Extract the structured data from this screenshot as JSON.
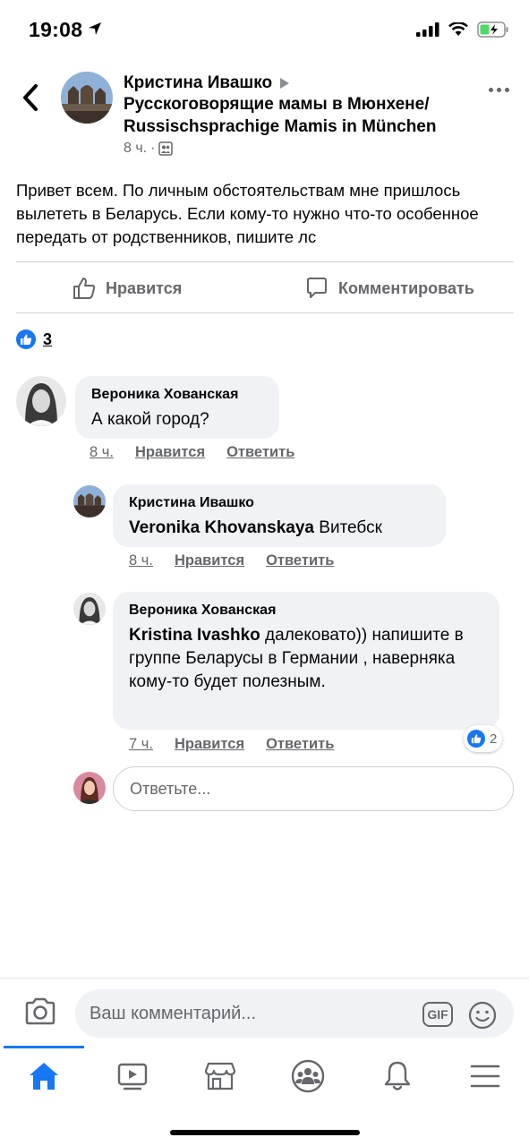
{
  "status_bar": {
    "time": "19:08"
  },
  "post": {
    "author": "Кристина Ивашко",
    "group": "Русскоговорящие мамы в Мюнхене/ Russischsprachige Mamis in München",
    "time": "8 ч.",
    "separator": "·",
    "text": "Привет всем. По личным обстоятельствам мне пришлось вылететь в Беларусь. Если кому-то нужно что-то особенное передать от родственников, пишите лс"
  },
  "actions": {
    "like_label": "Нравится",
    "comment_label": "Комментировать"
  },
  "reactions": {
    "count": "3"
  },
  "comments": [
    {
      "author": "Вероника Хованская",
      "text": "А какой город?",
      "time": "8 ч.",
      "like": "Нравится",
      "reply": "Ответить"
    },
    {
      "author": "Кристина Ивашко",
      "mention": "Veronika Khovanskaya",
      "text": " Витебск",
      "time": "8 ч.",
      "like": "Нравится",
      "reply": "Ответить"
    },
    {
      "author": "Вероника Хованская",
      "mention": "Kristina  Ivashko",
      "text": " далековато)) напишите в группе Беларусы в Германии , наверняка кому-то будет полезным.",
      "time": "7 ч.",
      "like": "Нравится",
      "reply": "Ответить",
      "reaction_count": "2"
    }
  ],
  "reply_input": {
    "placeholder": "Ответьте..."
  },
  "composer": {
    "placeholder": "Ваш комментарий...",
    "gif": "GIF"
  },
  "tabs": [
    {
      "icon": "home-icon",
      "active": true
    },
    {
      "icon": "watch-icon"
    },
    {
      "icon": "marketplace-icon"
    },
    {
      "icon": "groups-icon"
    },
    {
      "icon": "bell-icon"
    },
    {
      "icon": "menu-icon"
    }
  ],
  "colors": {
    "accent": "#1877f2",
    "muted": "#65676b",
    "bubble": "#f0f2f5"
  }
}
